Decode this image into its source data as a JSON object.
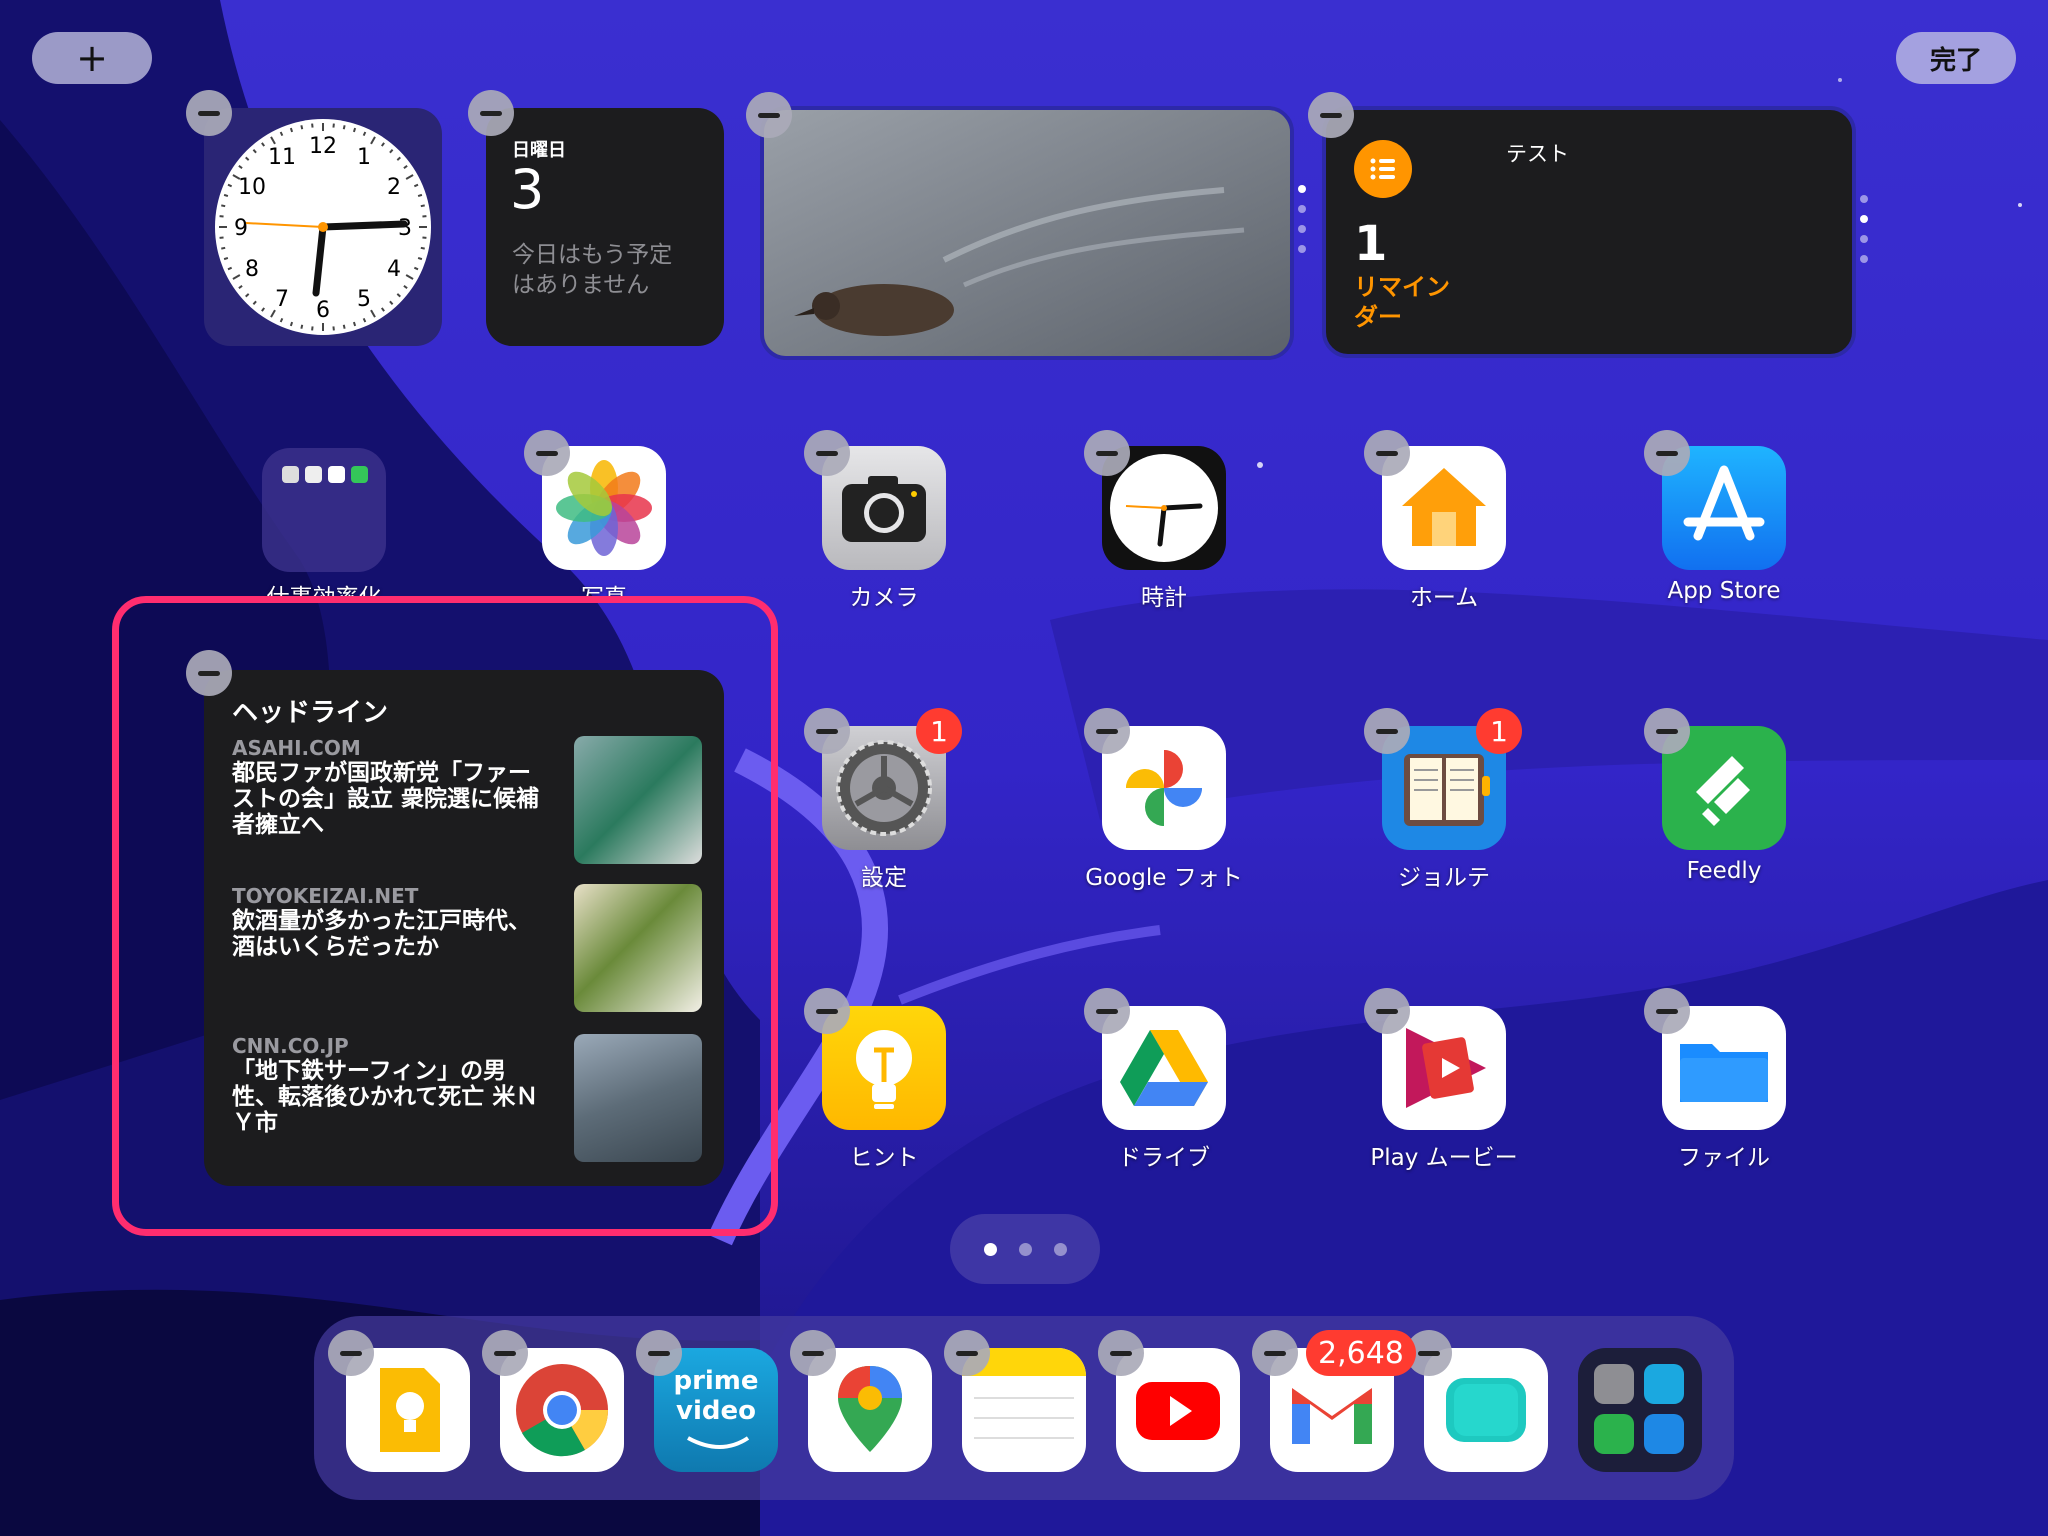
{
  "top_bar": {
    "add_label": "+",
    "done_label": "完了"
  },
  "widgets": {
    "calendar": {
      "weekday": "日曜日",
      "day": "3",
      "empty_text": "今日はもう予定はありません"
    },
    "reminders": {
      "list_name": "テスト",
      "count": "1",
      "label": "リマインダー"
    },
    "clock_numbers": [
      "12",
      "1",
      "2",
      "3",
      "4",
      "5",
      "6",
      "7",
      "8",
      "9",
      "10",
      "11"
    ],
    "news": {
      "title": "ヘッドライン",
      "items": [
        {
          "source": "ASAHI.COM",
          "headline": "都民ファが国政新党「ファーストの会」設立 衆院選に候補者擁立へ"
        },
        {
          "source": "TOYOKEIZAI.NET",
          "headline": "飲酒量が多かった江戸時代、酒はいくらだったか"
        },
        {
          "source": "CNN.CO.JP",
          "headline": "「地下鉄サーフィン」の男性、転落後ひかれて死亡 米ＮＹ市"
        }
      ]
    }
  },
  "apps": [
    {
      "label": "仕事効率化"
    },
    {
      "label": "写真"
    },
    {
      "label": "カメラ"
    },
    {
      "label": "時計"
    },
    {
      "label": "ホーム"
    },
    {
      "label": "App Store"
    },
    {
      "label": "設定",
      "badge": "1"
    },
    {
      "label": "Google フォト"
    },
    {
      "label": "ジョルテ",
      "badge": "1"
    },
    {
      "label": "Feedly"
    },
    {
      "label": "ヒント"
    },
    {
      "label": "ドライブ"
    },
    {
      "label": "Play ムービー"
    },
    {
      "label": "ファイル"
    }
  ],
  "dock": {
    "gmail_badge": "2,648",
    "prime_text_1": "prime",
    "prime_text_2": "video"
  },
  "colors": {
    "highlight": "#ff2d6f",
    "reminder_orange": "#ff9500",
    "badge_red": "#ff3b30"
  }
}
